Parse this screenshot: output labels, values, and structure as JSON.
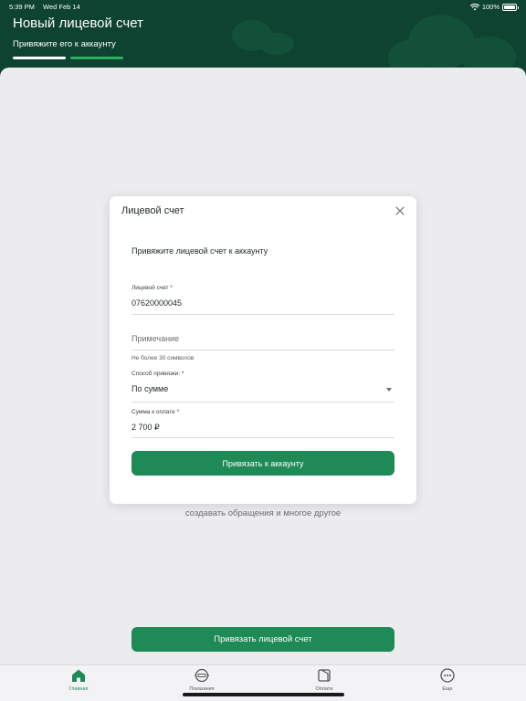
{
  "status_bar": {
    "time": "5:39 PM",
    "date": "Wed Feb 14",
    "battery": "100%"
  },
  "header": {
    "title": "Новый лицевой счет",
    "subtitle": "Привяжите его к аккаунту"
  },
  "background": {
    "partial_text": "создавать обращения и многое другое",
    "link_button": "Привязать лицевой счет"
  },
  "modal": {
    "title": "Лицевой счет",
    "description": "Привяжите лицевой счет к аккаунту",
    "account_field": {
      "label": "Лицевой счет *",
      "value": "07620000045"
    },
    "note_field": {
      "placeholder": "Примечание",
      "hint": "Не более 30 символов"
    },
    "method_field": {
      "label": "Способ привязки: *",
      "value": "По сумме"
    },
    "amount_field": {
      "label": "Сумма к оплате *",
      "value": "2 700 ₽"
    },
    "submit_button": "Привязать к аккаунту"
  },
  "tabs": [
    {
      "label": "Главная",
      "icon": "home-icon",
      "active": true
    },
    {
      "label": "Показания",
      "icon": "meter-icon",
      "active": false
    },
    {
      "label": "Оплата",
      "icon": "wallet-icon",
      "active": false
    },
    {
      "label": "Еще",
      "icon": "more-icon",
      "active": false
    }
  ],
  "colors": {
    "header_bg": "#0e4231",
    "accent": "#1e8a55",
    "progress_active": "#2bb05b"
  }
}
